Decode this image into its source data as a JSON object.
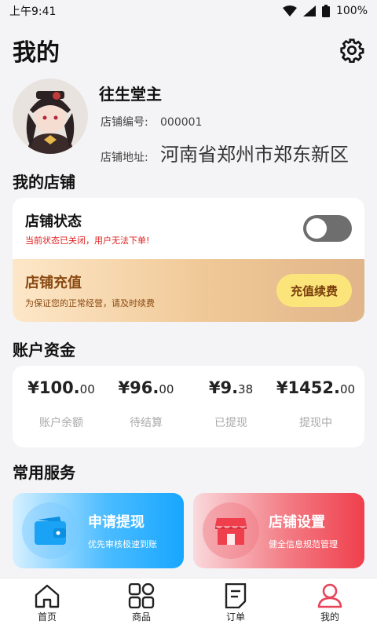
{
  "status_bar": {
    "time": "上午9:41",
    "battery": "100%"
  },
  "header": {
    "title": "我的"
  },
  "profile": {
    "name": "往生堂主",
    "store_no_label": "店铺编号:",
    "store_no": "000001",
    "address_label": "店铺地址:",
    "address": "河南省郑州市郑东新区"
  },
  "my_store": {
    "section_title": "我的店铺",
    "status_title": "店铺状态",
    "status_sub": "当前状态已关闭，用户无法下单!",
    "toggle_on": false,
    "recharge_title": "店铺充值",
    "recharge_sub": "为保证您的正常经营，请及时续费",
    "recharge_button": "充值续费"
  },
  "funds": {
    "section_title": "账户资金",
    "items": [
      {
        "int": "¥100.",
        "dec": "00",
        "label": "账户余额"
      },
      {
        "int": "¥96.",
        "dec": "00",
        "label": "待结算"
      },
      {
        "int": "¥9.",
        "dec": "38",
        "label": "已提现"
      },
      {
        "int": "¥1452.",
        "dec": "00",
        "label": "提现中"
      }
    ]
  },
  "services": {
    "section_title": "常用服务",
    "items": [
      {
        "title": "申请提现",
        "sub": "优先审核极速到账",
        "icon": "wallet-icon"
      },
      {
        "title": "店铺设置",
        "sub": "健全信息规范管理",
        "icon": "store-icon"
      }
    ]
  },
  "tabbar": {
    "items": [
      {
        "label": "首页",
        "icon": "home-icon"
      },
      {
        "label": "商品",
        "icon": "grid-icon"
      },
      {
        "label": "订单",
        "icon": "order-icon"
      },
      {
        "label": "我的",
        "icon": "user-icon",
        "active": true
      }
    ],
    "active_color": "#e8455a"
  },
  "colors": {
    "accent_red": "#e02020",
    "recharge_text": "#8a4a12",
    "recharge_button_bg": "#fbe57a",
    "service_blue": "#17a6ff",
    "service_red": "#ef3f4c"
  }
}
